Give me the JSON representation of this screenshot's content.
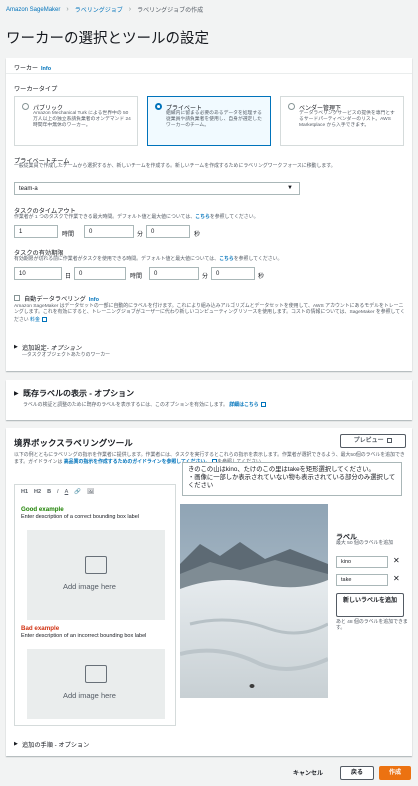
{
  "breadcrumb": {
    "root": "Amazon SageMaker",
    "jobs": "ラベリングジョブ",
    "current": "ラベリングジョブの作成"
  },
  "page_title": "ワーカーの選択とツールの設定",
  "workers": {
    "header": "ワーカー",
    "info": "Info",
    "type_label": "ワーカータイプ",
    "tiles": [
      {
        "title": "パブリック",
        "desc": "Amazon Mechanical Turk による世界中の 50 万人以上の独立系請負業者のオンデマンド 24 時間年中無休のワーカー。",
        "selected": false
      },
      {
        "title": "プライベート",
        "desc": "組織内に留まる必要のあるデータを処理する従業員や請負業者を使用し、自身が選定したワーカーのチーム。",
        "selected": true
      },
      {
        "title": "ベンダー管理下",
        "desc": "データラベリングサービスの提供を専門とするサードパーティベンダーのリスト。AWS Marketplace から入手できます。",
        "selected": false
      }
    ],
    "private_team_label": "プライベートチーム",
    "private_team_desc": "一般従業員で作成したチームから選択するか、新しいチームを作成する。新しいチームを作成するためにラベリングワークフォースに移動します。",
    "private_team_value": "team-a",
    "timeout_label": "タスクのタイムアウト",
    "timeout_desc_pre": "作業者が 1 つのタスクで作業できる最大時間。デフォルト値と最大値については、",
    "timeout_desc_link": "こちら",
    "timeout_desc_post": "を参照してください。",
    "timeout": {
      "hours": "1",
      "hours_unit": "時間",
      "minutes": "0",
      "minutes_unit": "分",
      "seconds": "0",
      "seconds_unit": "秒"
    },
    "expiry_label": "タスクの有効期限",
    "expiry_desc_pre": "有効期限が切れる前に作業者がタスクを使用できる時間。デフォルト値と最大値については、",
    "expiry_desc_link": "こちら",
    "expiry_desc_post": "を参照してください。",
    "expiry": {
      "days": "10",
      "days_unit": "日",
      "hours": "0",
      "hours_unit": "時間",
      "minutes": "0",
      "minutes_unit": "分",
      "seconds": "0",
      "seconds_unit": "秒"
    },
    "auto_label": "自動データラベリング",
    "auto_info": "Info",
    "auto_desc": "Amazon SageMaker はデータセットの一部に自動的にラベルを付けます。これにより組み込みアルゴリズムとデータセットを使用して、AWS アカウントにあるモデルをトレーニングします。これを有効にすると、トレーニングジョブがユーザーに代わり新しいコンピューティングリソースを使用します。コストの情報については、SageMaker を参照してください",
    "auto_link": "料金",
    "additional_label": "追加設定",
    "additional_sub": "- オプション",
    "additional_desc": "—タスクオブジェクトあたりのワーカー"
  },
  "existing_labels": {
    "title": "既存ラベルの表示 - オプション",
    "desc": "ラベルの検証と調整のために既存のラベルを表示するには、このオプションを有効にします。",
    "link": "詳細はこちら"
  },
  "tool": {
    "title": "境界ボックスラベリングツール",
    "preview_button": "プレビュー",
    "desc_line1": "以下の例とともにラベリングの指示を作業者に提供します。作業者には、タスクを実行するとこれらの指示を表示します。作業者が選択できるよう、最大50個のラベルを追加できます。ガイドラインは",
    "desc_link": "高品質の指示を作成するためのガイドラインを参照してください。",
    "desc_post": "を参照してください",
    "toolbar": [
      "H1",
      "H2",
      "B",
      "I",
      "A",
      "🔗",
      "🖼"
    ],
    "good_title": "Good example",
    "good_desc": "Enter description of a correct bounding box label",
    "bad_title": "Bad example",
    "bad_desc": "Enter description of an incorrect bounding box label",
    "add_image": "Add image here",
    "instruction_text": "きのこの山はkino、たけのこの里はtakeを矩形選択してください。\n・画像に一部しか表示されていない物も表示されている部分のみ選択してください",
    "labels_title": "ラベル",
    "labels_sub": "最大 50 個のラベルを追加",
    "labels": [
      "kino",
      "take"
    ],
    "add_label_button": "新しいラベルを追加",
    "remaining": "あと 48 個のラベルを追加できます。",
    "additional_steps": "追加の手順 - オプション"
  },
  "footer": {
    "cancel": "キャンセル",
    "back": "戻る",
    "create": "作成"
  },
  "colors": {
    "accent": "#0073bb",
    "primary": "#ec7211",
    "good": "#1d8102",
    "bad": "#d13212"
  }
}
